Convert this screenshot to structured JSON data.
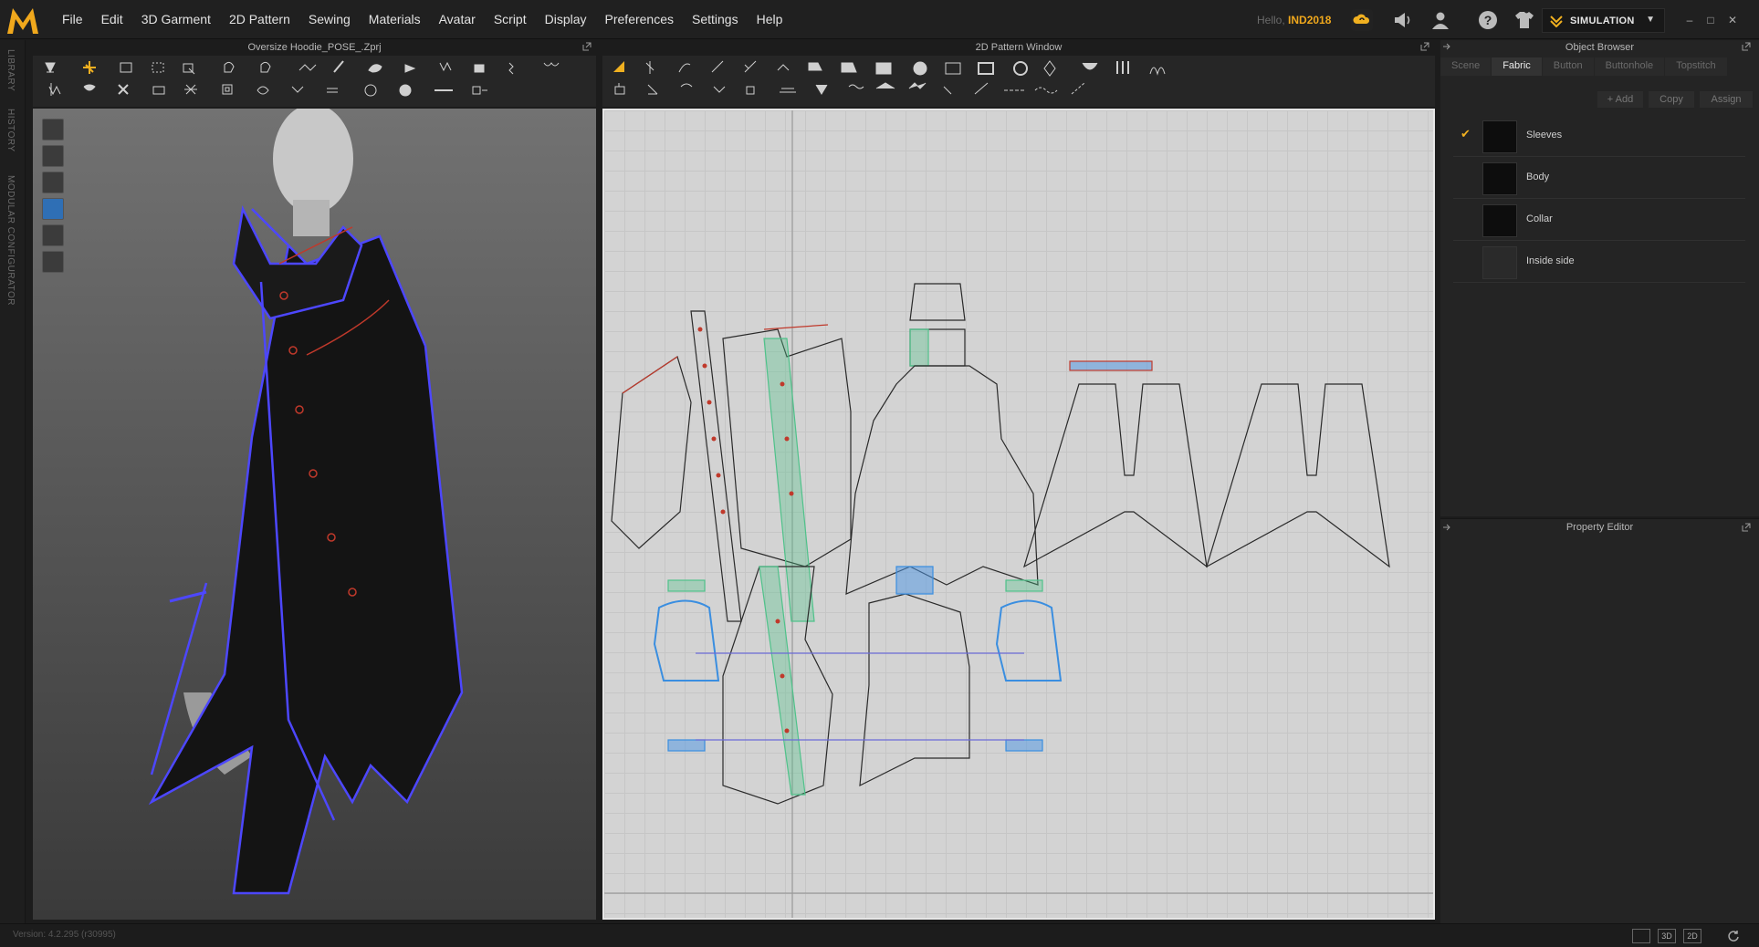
{
  "app": {
    "logo_letter": "M",
    "menus": [
      "File",
      "Edit",
      "3D Garment",
      "2D Pattern",
      "Sewing",
      "Materials",
      "Avatar",
      "Script",
      "Display",
      "Preferences",
      "Settings",
      "Help"
    ],
    "user_hello": "Hello,",
    "user_name": "IND2018",
    "mode_label": "SIMULATION",
    "accent": "#f0a81c",
    "seam_blue": "#4d47ff",
    "seam_red": "#c0392b",
    "seam_green": "#4fc28a"
  },
  "left_strip": {
    "tabs": [
      "LIBRARY",
      "HISTORY",
      "MODULAR CONFIGURATOR"
    ]
  },
  "panels": {
    "viewport_title": "Oversize Hoodie_POSE_.Zprj",
    "pattern_title": "2D Pattern Window",
    "object_browser_title": "Object Browser",
    "property_editor_title": "Property Editor"
  },
  "object_browser": {
    "tabs": [
      "Scene",
      "Fabric",
      "Button",
      "Buttonhole",
      "Topstitch"
    ],
    "active_tab": "Fabric",
    "buttons": {
      "add": "+ Add",
      "copy": "Copy",
      "assign": "Assign"
    },
    "fabrics": [
      {
        "name": "Sleeves",
        "checked": true,
        "swatch": "#0a0a0a"
      },
      {
        "name": "Body",
        "checked": false,
        "swatch": "#0a0a0a"
      },
      {
        "name": "Collar",
        "checked": false,
        "swatch": "#0a0a0a"
      },
      {
        "name": "Inside side",
        "checked": false,
        "swatch": "#2a2a2a"
      }
    ]
  },
  "status": {
    "version": "Version: 4.2.295 (r30995)",
    "view_buttons": [
      "",
      "3D",
      "2D"
    ]
  }
}
